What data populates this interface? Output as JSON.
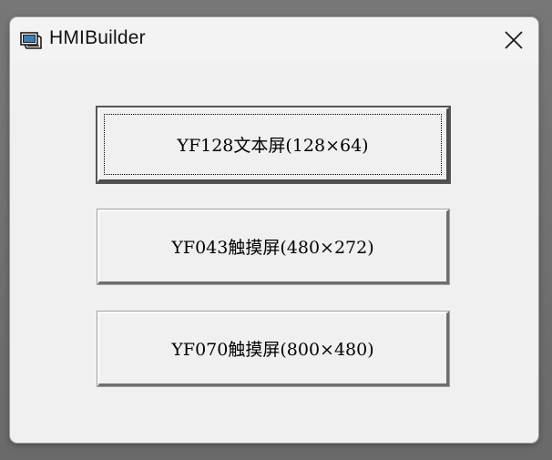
{
  "window": {
    "title": "HMIBuilder",
    "app_icon": "hmi-app-icon",
    "close_icon": "close-icon"
  },
  "buttons": [
    {
      "label": "YF128文本屏(128×64)",
      "focused": true
    },
    {
      "label": "YF043触摸屏(480×272)",
      "focused": false
    },
    {
      "label": "YF070触摸屏(800×480)",
      "focused": false
    }
  ]
}
